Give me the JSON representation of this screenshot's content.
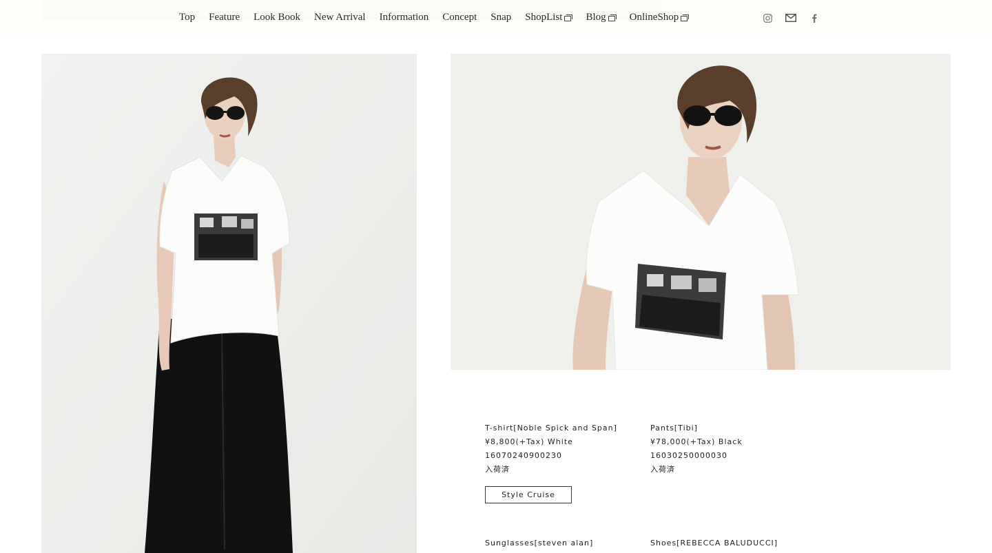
{
  "nav": {
    "items": [
      {
        "label": "Top",
        "external": false
      },
      {
        "label": "Feature",
        "external": false
      },
      {
        "label": "Look Book",
        "external": false
      },
      {
        "label": "New Arrival",
        "external": false
      },
      {
        "label": "Information",
        "external": false
      },
      {
        "label": "Concept",
        "external": false
      },
      {
        "label": "Snap",
        "external": false
      },
      {
        "label": "ShopList",
        "external": true
      },
      {
        "label": "Blog",
        "external": true
      },
      {
        "label": "OnlineShop",
        "external": true
      }
    ]
  },
  "social": [
    "instagram-icon",
    "mail-icon",
    "facebook-icon"
  ],
  "products": [
    {
      "name": "T-shirt[Noble Spick and Span]",
      "price": "¥8,800(+Tax) White",
      "code": "16070240900230",
      "status": "入荷済"
    },
    {
      "name": "Pants[Tibi]",
      "price": "¥78,000(+Tax) Black",
      "code": "16030250000030",
      "status": "入荷済"
    }
  ],
  "more_products": [
    {
      "name": "Sunglasses[steven alan]"
    },
    {
      "name": "Shoes[REBECCA BALUDUCCI]"
    }
  ],
  "style_button": {
    "label": "Style Cruise"
  },
  "colors": {
    "header_bg": "#fffef8",
    "photo_bg": "#efefed",
    "text": "#222222"
  }
}
